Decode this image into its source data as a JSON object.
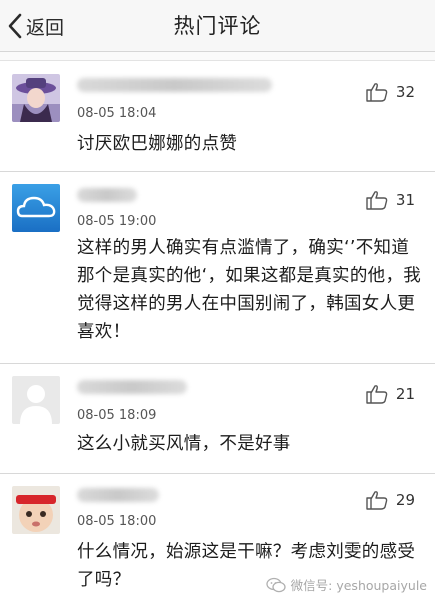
{
  "navbar": {
    "back_label": "返回",
    "title": "热门评论"
  },
  "comments": [
    {
      "time": "08-05 18:04",
      "likes": "32",
      "text": "讨厌欧巴娜娜的点赞",
      "avatar": "girl-with-hat-avatar"
    },
    {
      "time": "08-05 19:00",
      "likes": "31",
      "text": "这样的男人确实有点滥情了，确实‘’不知道那个是真实的他‘，如果这都是真实的他，我觉得这样的男人在中国别闹了，韩国女人更喜欢！",
      "avatar": "cloud-avatar"
    },
    {
      "time": "08-05 18:09",
      "likes": "21",
      "text": "这么小就买风情，不是好事",
      "avatar": "default-person-avatar"
    },
    {
      "time": "08-05 18:00",
      "likes": "29",
      "text": "什么情况，始源这是干嘛？考虑刘雯的感受了吗？",
      "avatar": "baby-with-headband-avatar"
    }
  ],
  "watermark": {
    "text": "微信号: yeshoupaiyule",
    "icon": "wechat-icon"
  },
  "icons": {
    "back": "chevron-left-icon",
    "like": "thumbs-up-icon"
  },
  "colors": {
    "navbar_bg": "#f7f7f7",
    "divider": "#d8d8d8",
    "text": "#1c1c1c",
    "meta": "#555555"
  }
}
